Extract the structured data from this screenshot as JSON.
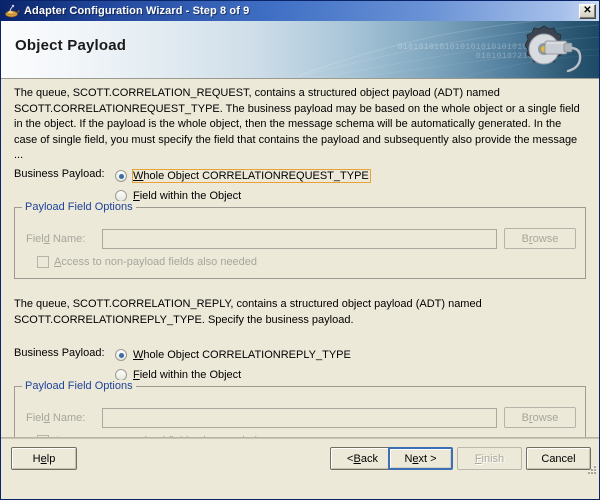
{
  "window": {
    "title": "Adapter Configuration Wizard - Step 8 of 9",
    "icon": "lamp-icon",
    "close_label": "✕"
  },
  "banner": {
    "title": "Object Payload",
    "binary_line1": "01010101010101010101010101",
    "binary_line2": "0101010?210",
    "accent_dark": "#1d4a66",
    "accent_light": "#fbfcfd"
  },
  "sections": [
    {
      "paragraph": "The queue, SCOTT.CORRELATION_REQUEST, contains a structured object payload (ADT) named SCOTT.CORRELATIONREQUEST_TYPE.  The business payload may be based on the whole object or a single field in the object. If the payload is the whole object, then the message schema will be automatically generated. In the case of single field, you must specify the field that contains the payload and subsequently also provide the message ...",
      "payload_label": "Business Payload:",
      "radios": [
        {
          "label_mnemonic": "W",
          "label_rest": "hole Object CORRELATIONREQUEST_TYPE",
          "checked": true,
          "focused": true
        },
        {
          "label_mnemonic": "F",
          "label_rest": "ield within the Object",
          "checked": false,
          "focused": false
        }
      ],
      "group": {
        "title": "Payload Field Options",
        "field_label_pre": "Fiel",
        "field_label_mnemonic": "d",
        "field_label_post": " Name:",
        "field_value": "",
        "field_placeholder": "",
        "browse_pre": "B",
        "browse_mnemonic": "r",
        "browse_post": "owse",
        "checkbox_mnemonic": "A",
        "checkbox_rest": "ccess to non-payload fields also needed",
        "checkbox_checked": false,
        "disabled": true
      }
    },
    {
      "paragraph": "The queue, SCOTT.CORRELATION_REPLY, contains a structured object payload (ADT) named SCOTT.CORRELATIONREPLY_TYPE.  Specify the business payload.",
      "payload_label": "Business Payload:",
      "radios": [
        {
          "label_mnemonic": "W",
          "label_rest": "hole Object CORRELATIONREPLY_TYPE",
          "checked": true,
          "focused": false
        },
        {
          "label_mnemonic": "F",
          "label_rest": "ield within the Object",
          "checked": false,
          "focused": false
        }
      ],
      "group": {
        "title": "Payload Field Options",
        "field_label_pre": "Fiel",
        "field_label_mnemonic": "d",
        "field_label_post": " Name:",
        "field_value": "",
        "field_placeholder": "",
        "browse_pre": "B",
        "browse_mnemonic": "r",
        "browse_post": "owse",
        "checkbox_mnemonic": "A",
        "checkbox_rest": "ccess to non-payload fields also needed",
        "checkbox_checked": false,
        "disabled": true
      }
    }
  ],
  "buttons": {
    "help": {
      "pre": "H",
      "mnemonic": "e",
      "post": "lp",
      "disabled": false,
      "default": false
    },
    "back": {
      "pre": "< ",
      "mnemonic": "B",
      "post": "ack",
      "disabled": false,
      "default": false
    },
    "next": {
      "pre": "N",
      "mnemonic": "e",
      "post": "xt >",
      "disabled": false,
      "default": true
    },
    "finish": {
      "pre": "",
      "mnemonic": "F",
      "post": "inish",
      "disabled": true,
      "default": false
    },
    "cancel": {
      "pre": "Cancel",
      "mnemonic": "",
      "post": "",
      "disabled": false,
      "default": false
    }
  },
  "colors": {
    "dialog_bg": "#ece9d8",
    "group_title": "#21439c",
    "focus_outline": "#e7a33a",
    "radio_dot": "#3a6ea5",
    "default_btn_border": "#3c6fb3",
    "disabled_text": "#a6a69b"
  }
}
